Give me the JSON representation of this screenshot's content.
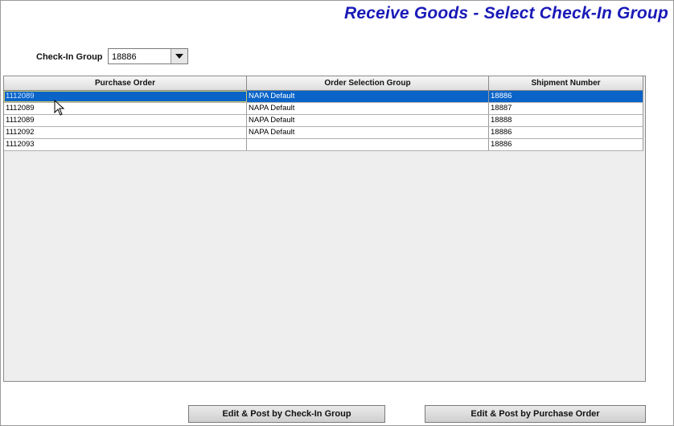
{
  "header": {
    "title": "Receive Goods - Select Check-In Group"
  },
  "checkin_group": {
    "label": "Check-In Group",
    "value": "18886"
  },
  "grid": {
    "columns": [
      "Purchase Order",
      "Order Selection Group",
      "Shipment Number"
    ],
    "rows": [
      {
        "po": "1112089",
        "group": "NAPA Default",
        "shipment": "18886",
        "selected": true
      },
      {
        "po": "1112089",
        "group": "NAPA Default",
        "shipment": "18887",
        "selected": false
      },
      {
        "po": "1112089",
        "group": "NAPA Default",
        "shipment": "18888",
        "selected": false
      },
      {
        "po": "1112092",
        "group": "NAPA Default",
        "shipment": "18886",
        "selected": false
      },
      {
        "po": "1112093",
        "group": "",
        "shipment": "18886",
        "selected": false
      }
    ]
  },
  "buttons": {
    "edit_by_group": "Edit & Post by Check-In Group",
    "edit_by_po": "Edit & Post by Purchase Order"
  },
  "colors": {
    "title": "#1a1ab8",
    "selection": "#0a64c8"
  }
}
